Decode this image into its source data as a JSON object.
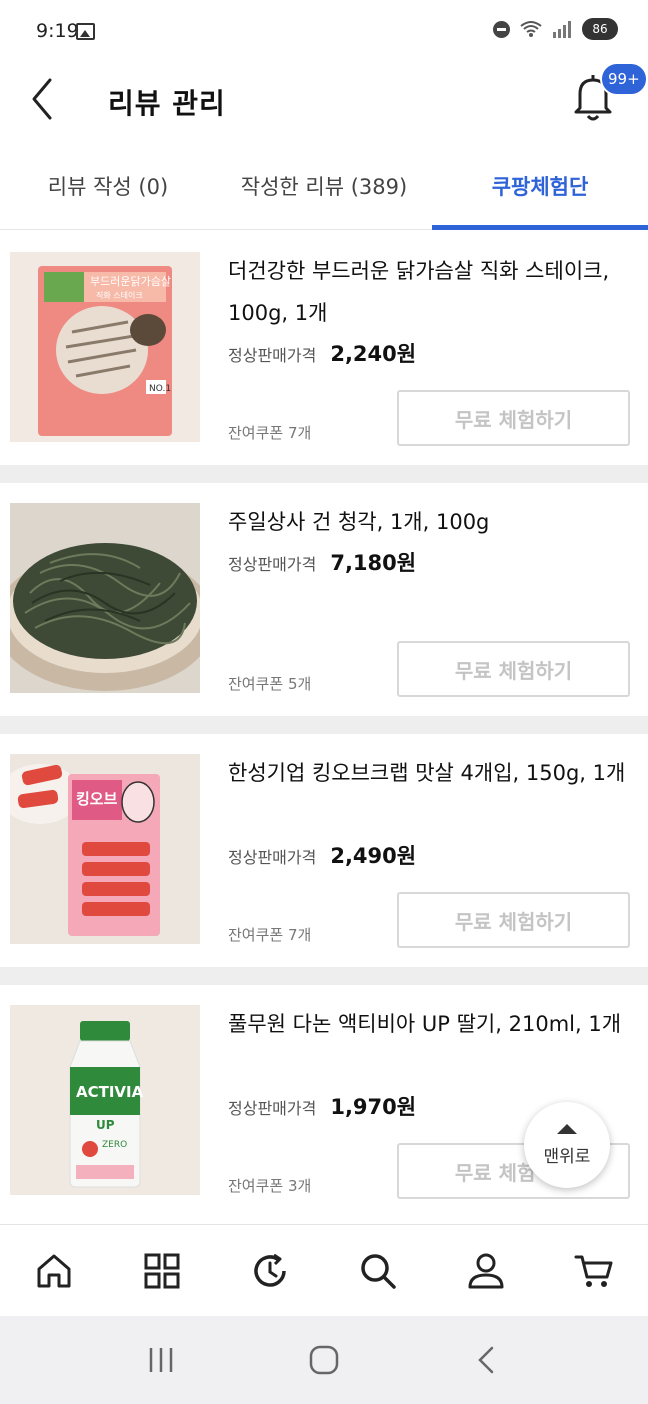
{
  "status_bar": {
    "time": "9:19",
    "battery": "86"
  },
  "header": {
    "title": "리뷰 관리",
    "badge": "99+"
  },
  "tabs": [
    {
      "label": "리뷰 작성 (0)",
      "active": false
    },
    {
      "label": "작성한 리뷰 (389)",
      "active": false
    },
    {
      "label": "쿠팡체험단",
      "active": true
    }
  ],
  "products": [
    {
      "name": "더건강한 부드러운 닭가슴살 직화 스테이크, 100g, 1개",
      "price_label": "정상판매가격",
      "price": "2,240원",
      "coupon": "잔여쿠폰 7개",
      "button": "무료 체험하기",
      "image": "chicken-steak-package"
    },
    {
      "name": "주일상사 건 청각, 1개, 100g",
      "price_label": "정상판매가격",
      "price": "7,180원",
      "coupon": "잔여쿠폰 5개",
      "button": "무료 체험하기",
      "image": "dried-seaweed-plate"
    },
    {
      "name": "한성기업 킹오브크랩 맛살 4개입, 150g, 1개",
      "price_label": "정상판매가격",
      "price": "2,490원",
      "coupon": "잔여쿠폰 7개",
      "button": "무료 체험하기",
      "image": "crab-stick-package"
    },
    {
      "name": "풀무원 다논 액티비아 UP 딸기, 210ml, 1개",
      "price_label": "정상판매가격",
      "price": "1,970원",
      "coupon": "잔여쿠폰 3개",
      "button": "무료 체험하기",
      "image": "activia-bottle"
    }
  ],
  "scroll_top": {
    "label": "맨위로"
  },
  "bottom_nav": [
    {
      "icon": "home-icon"
    },
    {
      "icon": "grid-icon"
    },
    {
      "icon": "history-icon"
    },
    {
      "icon": "search-icon"
    },
    {
      "icon": "user-icon"
    },
    {
      "icon": "cart-icon"
    }
  ],
  "colors": {
    "accent": "#2f63d8",
    "disabled_text": "#c4c4c4",
    "separator": "#eeeeee"
  }
}
